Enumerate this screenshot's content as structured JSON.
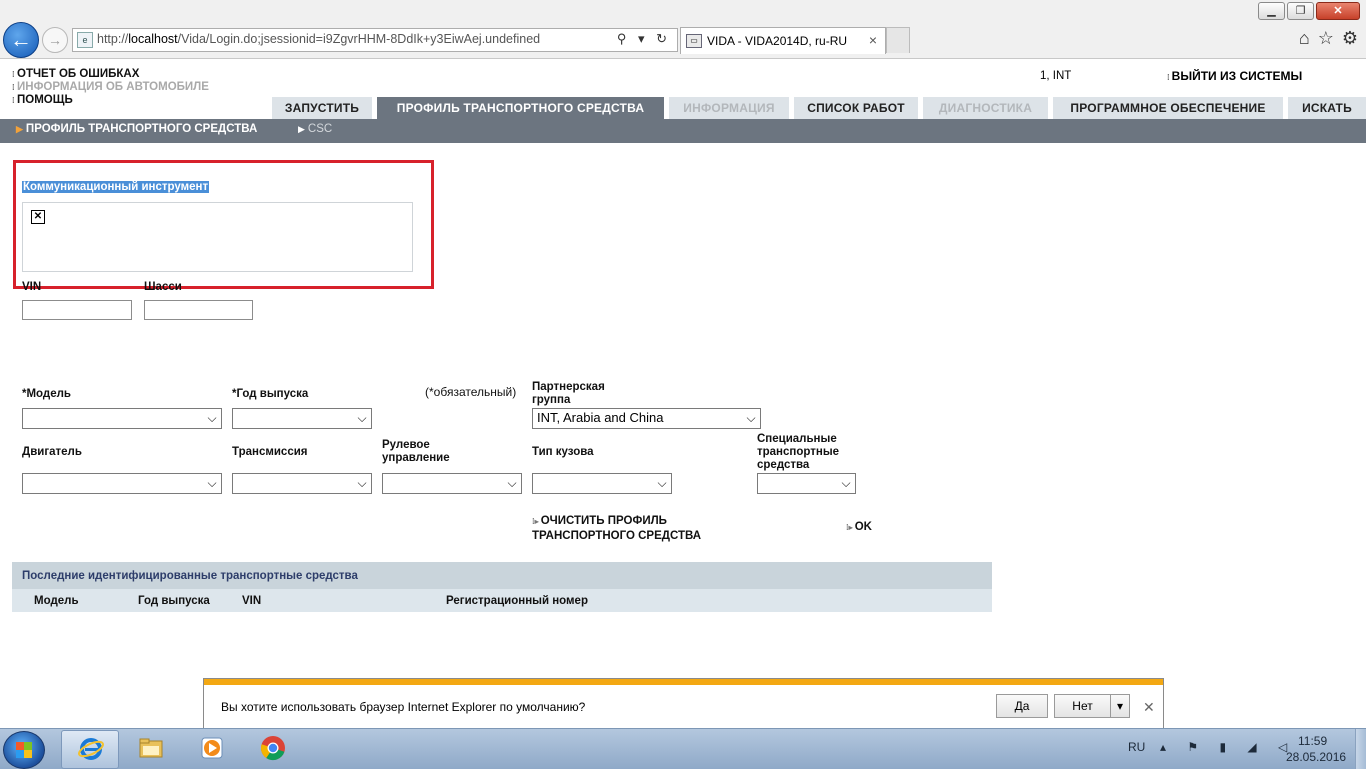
{
  "browser": {
    "window_buttons": {
      "minimize": "▁",
      "maximize": "❐",
      "close": "✕"
    },
    "back_glyph": "←",
    "forward_glyph": "→",
    "address_prefix": "http://",
    "address_host": "localhost",
    "address_path": "/Vida/Login.do;jsessionid=i9ZgvrHHM-8DdIk+y3EiwAej.undefined",
    "address_controls": "⚲ ▾ ↻",
    "tab_title": "VIDA - VIDA2014D, ru-RU",
    "tab_close": "×",
    "tools": {
      "home": "⌂",
      "favorites": "☆",
      "settings": "⚙"
    }
  },
  "header": {
    "links": [
      {
        "label": "ОТЧЕТ ОБ ОШИБКАХ",
        "disabled": false
      },
      {
        "label": "ИНФОРМАЦИЯ ОБ АВТОМОБИЛЕ",
        "disabled": true
      },
      {
        "label": "ПОМОЩЬ",
        "disabled": false
      }
    ],
    "user": "1, INT",
    "logout": "ВЫЙТИ ИЗ СИСТЕМЫ"
  },
  "tabs": [
    {
      "label": "ЗАПУСТИТЬ",
      "state": "normal"
    },
    {
      "label": "ПРОФИЛЬ ТРАНСПОРТНОГО СРЕДСТВА",
      "state": "active"
    },
    {
      "label": "ИНФОРМАЦИЯ",
      "state": "disabled"
    },
    {
      "label": "СПИСОК РАБОТ",
      "state": "normal"
    },
    {
      "label": "ДИАГНОСТИКА",
      "state": "disabled"
    },
    {
      "label": "ПРОГРАММНОЕ ОБЕСПЕЧЕНИЕ",
      "state": "normal"
    },
    {
      "label": "ИСКАТЬ",
      "state": "normal"
    }
  ],
  "subnav": [
    {
      "label": "ПРОФИЛЬ ТРАНСПОРТНОГО СРЕДСТВА",
      "active": true
    },
    {
      "label": "CSC",
      "active": false
    }
  ],
  "form": {
    "comm_tool_label": "Коммуникационный инструмент",
    "broken_image_glyph": "✕",
    "vin_label": "VIN",
    "vin_value": "",
    "chassis_label": "Шасси",
    "chassis_value": "",
    "model_label": "*Модель",
    "model_value": "",
    "year_label": "*Год выпуска",
    "year_value": "",
    "required_note": "(*обязательный)",
    "partner_group_label": "Партнерская группа",
    "partner_group_value": "INT, Arabia and China",
    "engine_label": "Двигатель",
    "engine_value": "",
    "transmission_label": "Трансмиссия",
    "transmission_value": "",
    "steering_label": "Рулевое управление",
    "steering_value": "",
    "body_label": "Тип кузова",
    "body_value": "",
    "special_label": "Специальные транспортные средства",
    "special_value": "",
    "clear_profile": "ОЧИСТИТЬ ПРОФИЛЬ ТРАНСПОРТНОГО СРЕДСТВА",
    "ok": "OK"
  },
  "recent": {
    "title": "Последние идентифицированные транспортные средства",
    "columns": [
      "Модель",
      "Год выпуска",
      "VIN",
      "Регистрационный номер"
    ]
  },
  "notification": {
    "text": "Вы хотите использовать браузер Internet Explorer по умолчанию?",
    "yes": "Да",
    "no": "Нет",
    "dropdown": "▾",
    "close": "✕"
  },
  "taskbar": {
    "apps": [
      "internet-explorer",
      "file-explorer",
      "media-player",
      "chrome"
    ],
    "language": "RU",
    "tray_glyphs": "▴ ⚑ ▮ ◢ ◁",
    "time": "11:59",
    "date": "28.05.2016"
  }
}
